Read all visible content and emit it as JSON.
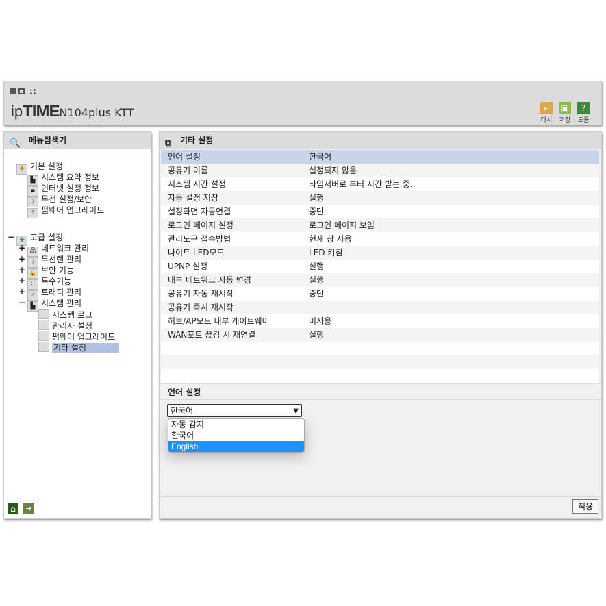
{
  "header": {
    "brand": "ipTIME",
    "model": "N104plus KTT",
    "buttons": [
      {
        "label": "다시",
        "color": "#d9a84a"
      },
      {
        "label": "저장",
        "color": "#8cbd4a"
      },
      {
        "label": "도움",
        "color": "#3d8a3a"
      }
    ]
  },
  "left_panel": {
    "title": "메뉴탐색기",
    "basic": {
      "label": "기본 설정",
      "items": [
        "시스템 요약 정보",
        "인터넷 설정 정보",
        "무선 설정/보안",
        "펌웨어 업그레이드"
      ]
    },
    "advanced": {
      "label": "고급 설정",
      "items": [
        "네트워크 관리",
        "무선랜 관리",
        "보안 기능",
        "특수기능",
        "트래픽 관리",
        "시스템 관리"
      ],
      "system_items": [
        "시스템 로그",
        "관리자 설정",
        "펌웨어 업그레이드",
        "기타 설정"
      ]
    }
  },
  "main": {
    "title": "기타 설정",
    "rows": [
      [
        "언어 설정",
        "한국어"
      ],
      [
        "공유기 이름",
        "설정되지 않음"
      ],
      [
        "시스템 시간 설정",
        "타임서버로 부터 시간 받는 중.."
      ],
      [
        "자동 설정 저장",
        "실행"
      ],
      [
        "설정화면 자동연결",
        "중단"
      ],
      [
        "로그인 페이지 설정",
        "로그인 페이지 보임"
      ],
      [
        "관리도구 접속방법",
        "현재 창 사용"
      ],
      [
        "나이트 LED모드",
        "LED 켜짐"
      ],
      [
        "UPNP 설정",
        "실행"
      ],
      [
        "내부 네트워크 자동 변경",
        "실행"
      ],
      [
        "공유기 자동 재시작",
        "중단"
      ],
      [
        "공유기 즉시 재시작",
        ""
      ],
      [
        "허브/AP모드 내부 게이트웨이",
        "미사용"
      ],
      [
        "WAN포트 끊김 시 재연결",
        "실행"
      ]
    ],
    "detail_title": "언어 설정",
    "select_value": "한국어",
    "options": [
      "자동 감지",
      "한국어",
      "English"
    ],
    "apply": "적용"
  },
  "colors": {
    "selected_row": "#c8d4ea",
    "option_highlight": "#1e90ff"
  }
}
